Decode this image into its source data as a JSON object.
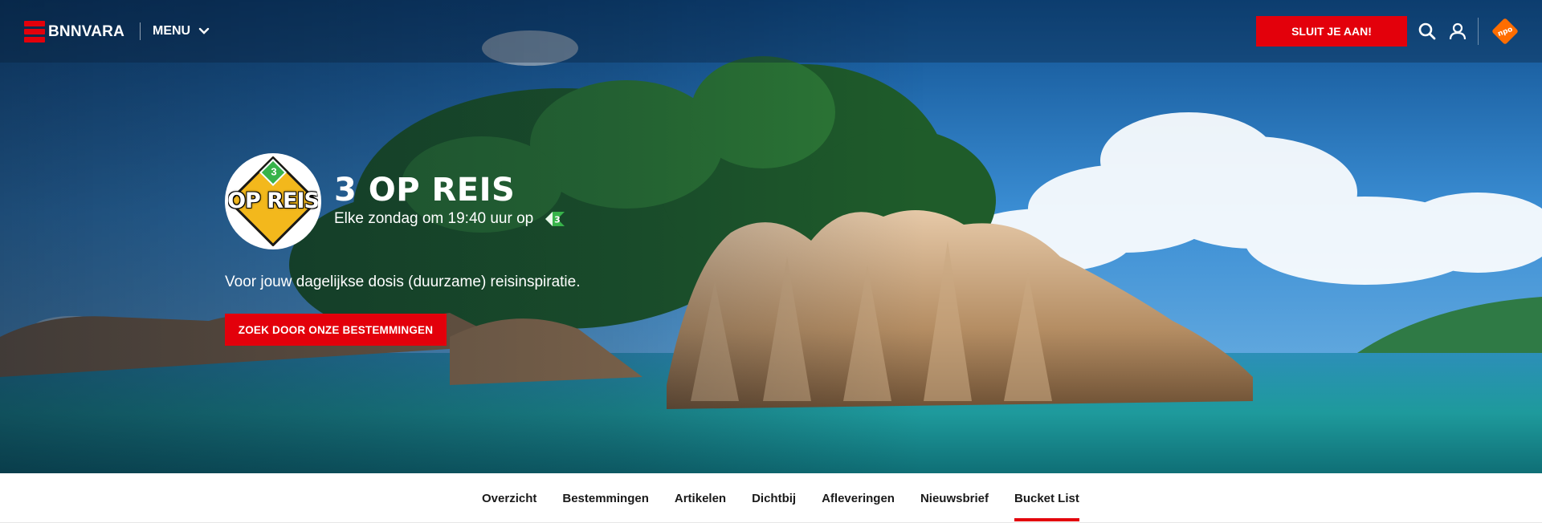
{
  "header": {
    "brand": "BNNVARA",
    "menu_label": "MENU",
    "join_button": "SLUIT JE AAN!",
    "icons": [
      "search-icon",
      "user-icon",
      "npo-logo-icon"
    ]
  },
  "hero": {
    "show_logo_text": "OP REIS",
    "show_logo_channel": "3",
    "title": "3 OP REIS",
    "schedule": "Elke zondag om 19:40 uur op",
    "channel_badge": "3",
    "tagline": "Voor jouw dagelijkse dosis (duurzame) reisinspiratie.",
    "cta_label": "ZOEK DOOR ONZE BESTEMMINGEN"
  },
  "subnav": {
    "items": [
      {
        "label": "Overzicht",
        "active": false
      },
      {
        "label": "Bestemmingen",
        "active": false
      },
      {
        "label": "Artikelen",
        "active": false
      },
      {
        "label": "Dichtbij",
        "active": false
      },
      {
        "label": "Afleveringen",
        "active": false
      },
      {
        "label": "Nieuwsbrief",
        "active": false
      },
      {
        "label": "Bucket List",
        "active": true
      }
    ]
  },
  "colors": {
    "accent": "#e3000b",
    "npo_orange": "#ff6d00",
    "npo3_green": "#37b34a",
    "logo_yellow": "#f3b81c"
  }
}
